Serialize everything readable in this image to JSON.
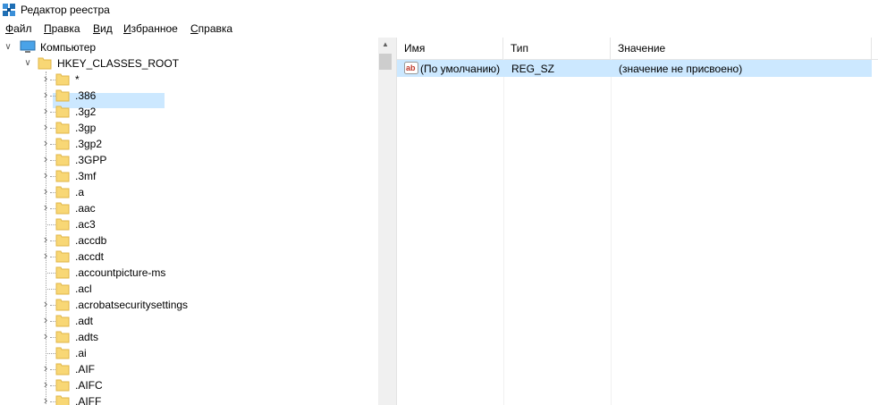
{
  "window": {
    "title": "Редактор реестра",
    "icon": "registry-editor-icon"
  },
  "menu": [
    {
      "accel": "Ф",
      "rest": "айл"
    },
    {
      "accel": "П",
      "rest": "равка"
    },
    {
      "accel": "В",
      "rest": "ид"
    },
    {
      "accel": "И",
      "rest": "збранное"
    },
    {
      "accel": "С",
      "rest": "правка"
    }
  ],
  "tree": {
    "root": "Компьютер",
    "hive": "HKEY_CLASSES_ROOT",
    "keys": [
      {
        "name": "*",
        "expandable": true
      },
      {
        "name": ".386",
        "expandable": true
      },
      {
        "name": ".3g2",
        "expandable": true
      },
      {
        "name": ".3gp",
        "expandable": true
      },
      {
        "name": ".3gp2",
        "expandable": true
      },
      {
        "name": ".3GPP",
        "expandable": true
      },
      {
        "name": ".3mf",
        "expandable": true
      },
      {
        "name": ".a",
        "expandable": true
      },
      {
        "name": ".aac",
        "expandable": true
      },
      {
        "name": ".ac3",
        "expandable": false
      },
      {
        "name": ".accdb",
        "expandable": true
      },
      {
        "name": ".accdt",
        "expandable": true
      },
      {
        "name": ".accountpicture-ms",
        "expandable": false
      },
      {
        "name": ".acl",
        "expandable": false
      },
      {
        "name": ".acrobatsecuritysettings",
        "expandable": true
      },
      {
        "name": ".adt",
        "expandable": true
      },
      {
        "name": ".adts",
        "expandable": true
      },
      {
        "name": ".ai",
        "expandable": false
      },
      {
        "name": ".AIF",
        "expandable": true
      },
      {
        "name": ".AIFC",
        "expandable": true
      },
      {
        "name": ".AIFF",
        "expandable": true
      }
    ]
  },
  "list": {
    "columns": {
      "name": "Имя",
      "type": "Тип",
      "value": "Значение"
    },
    "rows": [
      {
        "name": "(По умолчанию)",
        "type": "REG_SZ",
        "value": "(значение не присвоено)",
        "icon": "reg-sz-icon"
      }
    ]
  },
  "colors": {
    "selection": "#cce8ff",
    "folder": "#f8d775",
    "folder_dark": "#e0b646"
  }
}
